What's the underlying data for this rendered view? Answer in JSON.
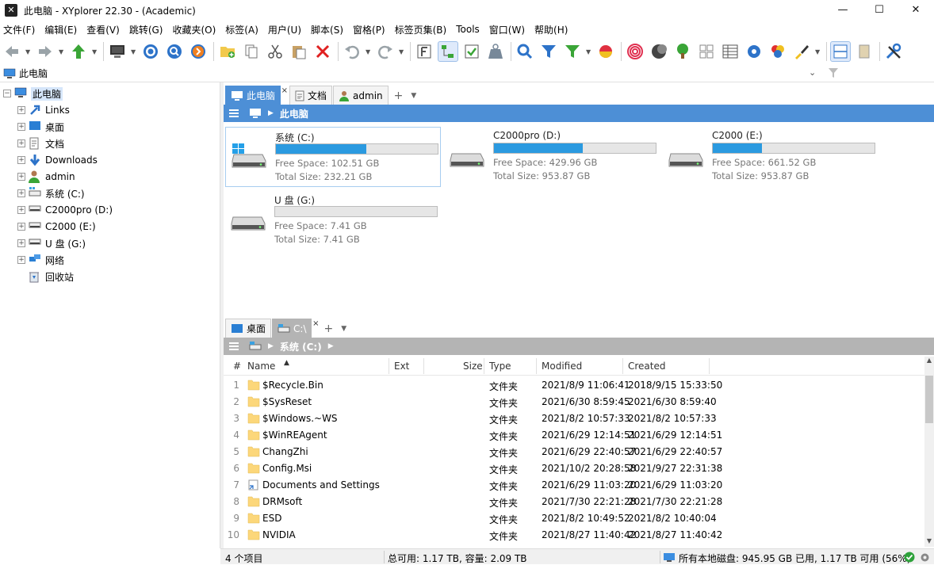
{
  "window": {
    "title": "此电脑 - XYplorer 22.30 - (Academic)",
    "min": "—",
    "max": "☐",
    "close": "✕"
  },
  "menu": [
    "文件(F)",
    "编辑(E)",
    "查看(V)",
    "跳转(G)",
    "收藏夹(O)",
    "标签(A)",
    "用户(U)",
    "脚本(S)",
    "窗格(P)",
    "标签页集(B)",
    "Tools",
    "窗口(W)",
    "帮助(H)"
  ],
  "address": {
    "text": "此电脑"
  },
  "tree": [
    {
      "label": "此电脑",
      "icon": "computer-icon",
      "expander": "−",
      "selected": true
    },
    {
      "label": "Links",
      "icon": "link-icon",
      "expander": "+"
    },
    {
      "label": "桌面",
      "icon": "desktop-icon",
      "expander": "+"
    },
    {
      "label": "文档",
      "icon": "document-icon",
      "expander": "+"
    },
    {
      "label": "Downloads",
      "icon": "download-icon",
      "expander": "+"
    },
    {
      "label": "admin",
      "icon": "user-icon",
      "expander": "+"
    },
    {
      "label": "系统 (C:)",
      "icon": "system-drive-icon",
      "expander": "+"
    },
    {
      "label": "C2000pro (D:)",
      "icon": "drive-icon",
      "expander": "+"
    },
    {
      "label": "C2000 (E:)",
      "icon": "drive-icon",
      "expander": "+"
    },
    {
      "label": "U 盘 (G:)",
      "icon": "drive-icon",
      "expander": "+"
    },
    {
      "label": "网络",
      "icon": "network-icon",
      "expander": "+"
    },
    {
      "label": "回收站",
      "icon": "recycle-bin-icon",
      "expander": ""
    }
  ],
  "pane1": {
    "tabs": [
      {
        "label": "此电脑",
        "close": "×"
      },
      {
        "label": "文档"
      },
      {
        "label": "admin"
      }
    ],
    "plus": "+",
    "dropdown": "▼",
    "crumb": "此电脑",
    "drives": [
      {
        "name": "系统 (C:)",
        "used_fraction": 0.558,
        "free": "Free Space: 102.51 GB",
        "total": "Total Size: 232.21 GB",
        "selected": true
      },
      {
        "name": "C2000pro (D:)",
        "used_fraction": 0.549,
        "free": "Free Space: 429.96 GB",
        "total": "Total Size: 953.87 GB"
      },
      {
        "name": "C2000 (E:)",
        "used_fraction": 0.306,
        "free": "Free Space: 661.52 GB",
        "total": "Total Size: 953.87 GB"
      },
      {
        "name": "U 盘 (G:)",
        "used_fraction": 0.0,
        "free": "Free Space: 7.41 GB",
        "total": "Total Size: 7.41 GB"
      }
    ]
  },
  "pane2": {
    "tabs": [
      {
        "label": "桌面"
      },
      {
        "label": "C:\\",
        "close": "×"
      }
    ],
    "plus": "+",
    "dropdown": "▼",
    "crumb": "系统 (C:)",
    "columns": {
      "num": "#",
      "name": "Name",
      "ext": "Ext",
      "size": "Size",
      "type": "Type",
      "modified": "Modified",
      "created": "Created"
    },
    "rows": [
      {
        "num": "1",
        "name": "$Recycle.Bin",
        "type": "文件夹",
        "modified": "2021/8/9 11:06:41",
        "created": "2018/9/15 15:33:50"
      },
      {
        "num": "2",
        "name": "$SysReset",
        "type": "文件夹",
        "modified": "2021/6/30 8:59:45",
        "created": "2021/6/30 8:59:40"
      },
      {
        "num": "3",
        "name": "$Windows.~WS",
        "type": "文件夹",
        "modified": "2021/8/2 10:57:33",
        "created": "2021/8/2 10:57:33"
      },
      {
        "num": "4",
        "name": "$WinREAgent",
        "type": "文件夹",
        "modified": "2021/6/29 12:14:51",
        "created": "2021/6/29 12:14:51"
      },
      {
        "num": "5",
        "name": "ChangZhi",
        "type": "文件夹",
        "modified": "2021/6/29 22:40:57",
        "created": "2021/6/29 22:40:57"
      },
      {
        "num": "6",
        "name": "Config.Msi",
        "type": "文件夹",
        "modified": "2021/10/2 20:28:58",
        "created": "2021/9/27 22:31:38"
      },
      {
        "num": "7",
        "name": "Documents and Settings",
        "type": "文件夹",
        "modified": "2021/6/29 11:03:20",
        "created": "2021/6/29 11:03:20",
        "junction": true
      },
      {
        "num": "8",
        "name": "DRMsoft",
        "type": "文件夹",
        "modified": "2021/7/30 22:21:28",
        "created": "2021/7/30 22:21:28"
      },
      {
        "num": "9",
        "name": "ESD",
        "type": "文件夹",
        "modified": "2021/8/2 10:49:52",
        "created": "2021/8/2 10:40:04"
      },
      {
        "num": "10",
        "name": "NVIDIA",
        "type": "文件夹",
        "modified": "2021/8/27 11:40:42",
        "created": "2021/8/27 11:40:42"
      }
    ]
  },
  "status": {
    "items": "4 个项目",
    "disk": "总可用: 1.17 TB, 容量: 2.09 TB",
    "all": "所有本地磁盘: 945.95 GB 已用,  1.17 TB 可用 (56%)"
  }
}
